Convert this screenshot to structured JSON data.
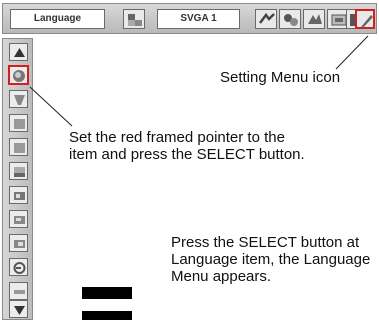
{
  "toolbar": {
    "language_label": "Language",
    "signal_label": "SVGA 1",
    "icons": [
      "image-adjust-icon",
      "signal-input-icon",
      "pc-adjust-icon",
      "image-select-icon",
      "screen-icon",
      "sound-icon",
      "setting-menu-icon"
    ]
  },
  "left_menu": {
    "items": [
      "scroll-up-icon",
      "pointer-selected-icon",
      "menu-item-icon",
      "menu-item-icon",
      "menu-item-icon",
      "menu-item-icon",
      "menu-item-icon",
      "menu-item-icon",
      "menu-item-icon",
      "menu-item-icon",
      "menu-item-icon",
      "scroll-down-icon"
    ]
  },
  "captions": {
    "setting_menu_icon": "Setting Menu icon",
    "pointer_instruction": "Set the red framed pointer to the item and press the SELECT button.",
    "language_instruction": "Press the SELECT button at Language item, the Language Menu appears."
  },
  "colors": {
    "pointer_frame": "#d02020",
    "toolbar_bg": "#c8c8c8"
  }
}
